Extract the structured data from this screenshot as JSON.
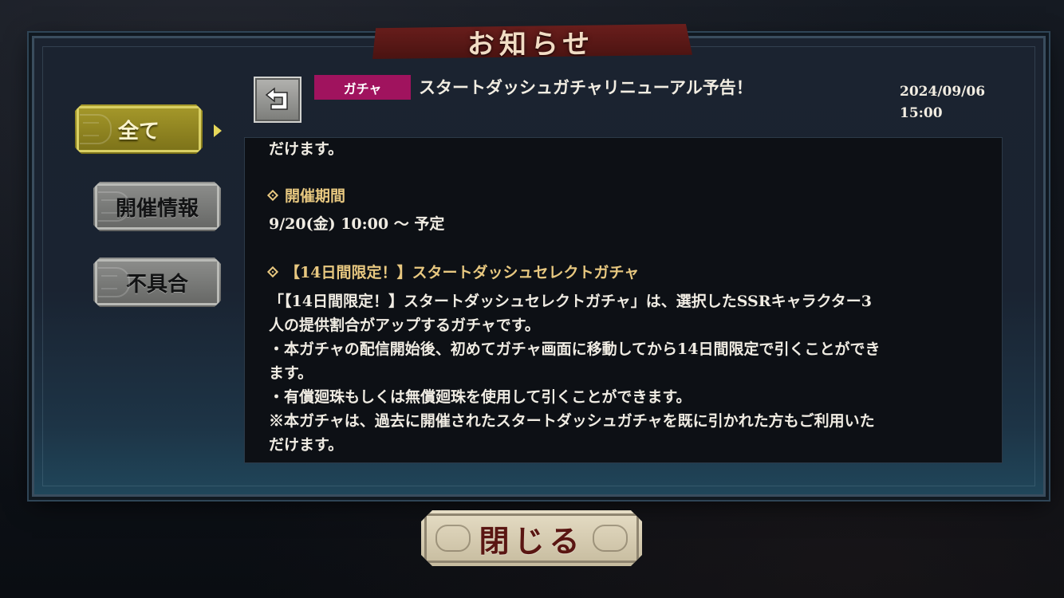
{
  "header": {
    "title": "お知らせ"
  },
  "sidebar": {
    "items": [
      {
        "label": "全て",
        "selected": true
      },
      {
        "label": "開催情報",
        "selected": false
      },
      {
        "label": "不具合",
        "selected": false
      }
    ]
  },
  "notice": {
    "category": "ガチャ",
    "title": "スタートダッシュガチャリニューアル予告！",
    "date": "2024/09/06",
    "time": "15:00"
  },
  "content": {
    "lines": [
      {
        "text": "だけます。",
        "type": "body"
      },
      {
        "text": "開催期間",
        "type": "heading"
      },
      {
        "text": "9/20(金) 10:00 〜 予定",
        "type": "body"
      },
      {
        "text": "【14日間限定！】スタートダッシュセレクトガチャ",
        "type": "heading"
      },
      {
        "text": "「【14日間限定！】スタートダッシュセレクトガチャ」は、選択したSSRキャラクター3",
        "type": "body"
      },
      {
        "text": "人の提供割合がアップするガチャです。",
        "type": "body"
      },
      {
        "text": "・本ガチャの配信開始後、初めてガチャ画面に移動してから14日間限定で引くことができ",
        "type": "body"
      },
      {
        "text": "ます。",
        "type": "body"
      },
      {
        "text": "・有償廻珠もしくは無償廻珠を使用して引くことができます。",
        "type": "body"
      },
      {
        "text": "※本ガチャは、過去に開催されたスタートダッシュガチャを既に引かれた方もご利用いた",
        "type": "body"
      },
      {
        "text": "だけます。",
        "type": "body"
      }
    ]
  },
  "footer": {
    "close_label": "閉じる"
  },
  "colors": {
    "badge": "#a0135e",
    "heading": "#e8c880",
    "selected_tab": "#a79a2b",
    "banner": "#6a1e1c"
  },
  "icons": {
    "back": "return-arrow-icon",
    "heading_marker": "diamond-icon",
    "selected_marker": "triangle-right-icon"
  }
}
